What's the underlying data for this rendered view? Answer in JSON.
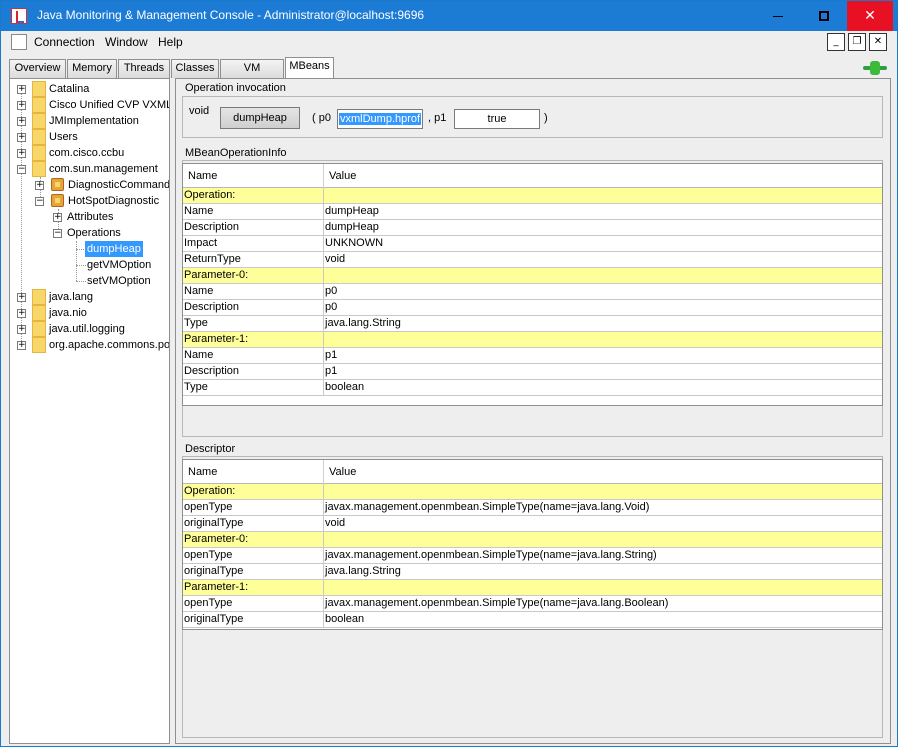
{
  "window": {
    "title": "Java Monitoring & Management Console - Administrator@localhost:9696",
    "min_glyph": "",
    "close_glyph": "✕"
  },
  "menu": {
    "items": [
      "Connection",
      "Window",
      "Help"
    ],
    "mdi_min": "_",
    "mdi_restore": "❐",
    "mdi_close": "✕"
  },
  "tabs": [
    "Overview",
    "Memory",
    "Threads",
    "Classes",
    "VM Summary",
    "MBeans"
  ],
  "active_tab": "MBeans",
  "tree": {
    "expand_glyph": "+",
    "collapse_glyph": "−",
    "nodes": [
      {
        "label": "Catalina"
      },
      {
        "label": "Cisco Unified CVP VXML S"
      },
      {
        "label": "JMImplementation"
      },
      {
        "label": "Users"
      },
      {
        "label": "com.cisco.ccbu"
      },
      {
        "label": "com.sun.management"
      },
      {
        "label": "DiagnosticCommand"
      },
      {
        "label": "HotSpotDiagnostic"
      },
      {
        "label": "Attributes"
      },
      {
        "label": "Operations"
      },
      {
        "label": "dumpHeap"
      },
      {
        "label": "getVMOption"
      },
      {
        "label": "setVMOption"
      },
      {
        "label": "java.lang"
      },
      {
        "label": "java.nio"
      },
      {
        "label": "java.util.logging"
      },
      {
        "label": "org.apache.commons.po"
      }
    ],
    "selected": "dumpHeap"
  },
  "invocation": {
    "title": "Operation invocation",
    "return_type": "void",
    "button_label": "dumpHeap",
    "open_paren": "( p0",
    "p0_value": "vxmlDump.hprof",
    "separator": ", p1",
    "p1_value": "true",
    "close_paren": ")"
  },
  "operation_info": {
    "title": "MBeanOperationInfo",
    "headers": [
      "Name",
      "Value"
    ],
    "rows": [
      {
        "name": "Operation:",
        "value": "",
        "section": true
      },
      {
        "name": "Name",
        "value": "dumpHeap"
      },
      {
        "name": "Description",
        "value": "dumpHeap"
      },
      {
        "name": "Impact",
        "value": "UNKNOWN"
      },
      {
        "name": "ReturnType",
        "value": "void"
      },
      {
        "name": "Parameter-0:",
        "value": "",
        "section": true
      },
      {
        "name": "Name",
        "value": "p0"
      },
      {
        "name": "Description",
        "value": "p0"
      },
      {
        "name": "Type",
        "value": "java.lang.String"
      },
      {
        "name": "Parameter-1:",
        "value": "",
        "section": true
      },
      {
        "name": "Name",
        "value": "p1"
      },
      {
        "name": "Description",
        "value": "p1"
      },
      {
        "name": "Type",
        "value": "boolean"
      }
    ]
  },
  "descriptor": {
    "title": "Descriptor",
    "headers": [
      "Name",
      "Value"
    ],
    "rows": [
      {
        "name": "Operation:",
        "value": "",
        "section": true
      },
      {
        "name": "openType",
        "value": "javax.management.openmbean.SimpleType(name=java.lang.Void)"
      },
      {
        "name": "originalType",
        "value": "void"
      },
      {
        "name": "Parameter-0:",
        "value": "",
        "section": true
      },
      {
        "name": "openType",
        "value": "javax.management.openmbean.SimpleType(name=java.lang.String)"
      },
      {
        "name": "originalType",
        "value": "java.lang.String"
      },
      {
        "name": "Parameter-1:",
        "value": "",
        "section": true
      },
      {
        "name": "openType",
        "value": "javax.management.openmbean.SimpleType(name=java.lang.Boolean)"
      },
      {
        "name": "originalType",
        "value": "boolean"
      }
    ]
  },
  "colors": {
    "titlebar": "#1c7bd5",
    "section_row": "#ffff99",
    "selection": "#3399ff",
    "close_button": "#e81123"
  }
}
